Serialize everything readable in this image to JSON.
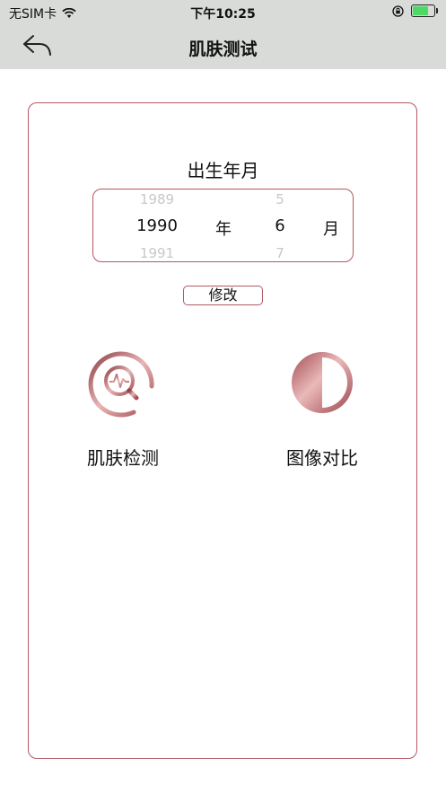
{
  "status_bar": {
    "carrier": "无SIM卡",
    "time": "下午10:25",
    "battery_level": 0.85,
    "battery_color": "#4cd964"
  },
  "nav": {
    "back_icon": "back-arrow-icon",
    "title": "肌肤测试"
  },
  "birth": {
    "label": "出生年月",
    "year_prev": "1989",
    "year": "1990",
    "year_next": "1991",
    "year_unit": "年",
    "month_prev": "5",
    "month": "6",
    "month_next": "7",
    "month_unit": "月"
  },
  "modify_label": "修改",
  "features": [
    {
      "label": "肌肤检测",
      "icon": "skin-scan-icon"
    },
    {
      "label": "图像对比",
      "icon": "half-circle-compare-icon"
    }
  ],
  "accent_color": "#b2585f"
}
